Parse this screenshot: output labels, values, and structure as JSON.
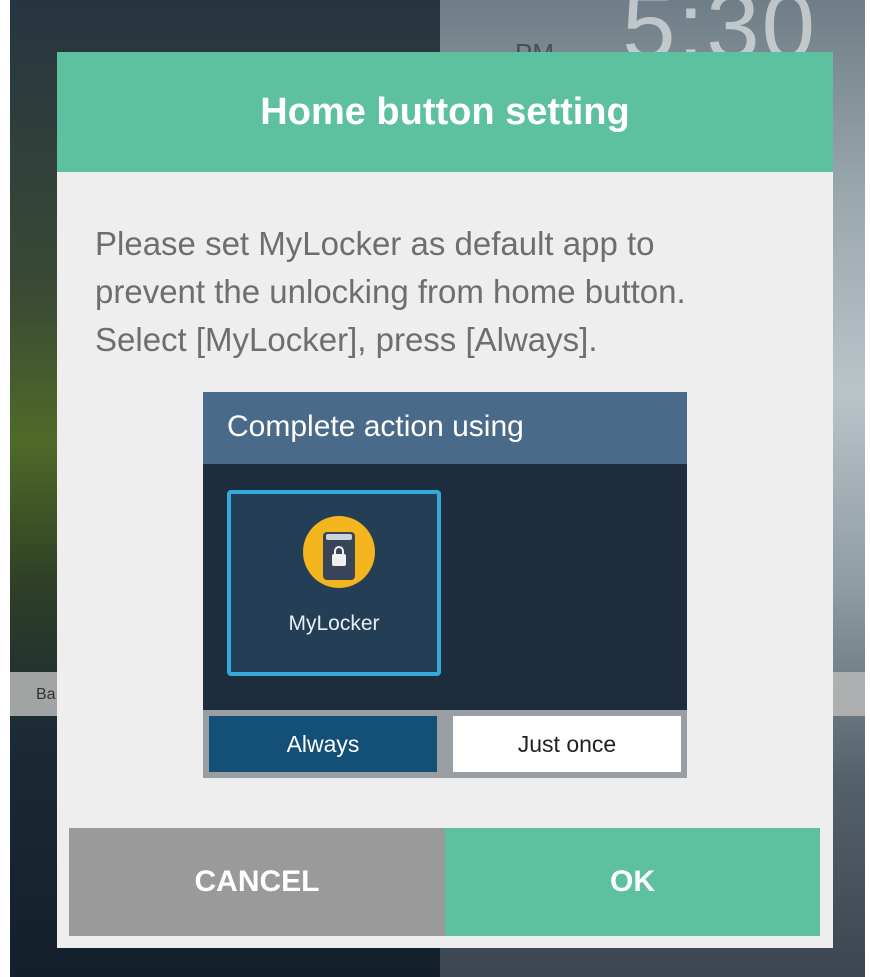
{
  "background": {
    "clock": "5:30",
    "ampm": "PM",
    "strip_text": "Ba"
  },
  "dialog": {
    "title": "Home button setting",
    "message_lines": [
      "Please set MyLocker as default app to",
      "prevent the unlocking from home button.",
      "Select [MyLocker], press [Always]."
    ],
    "illustration": {
      "title": "Complete action using",
      "app": {
        "label": "MyLocker",
        "icon": "lock-phone-icon"
      },
      "always_label": "Always",
      "just_once_label": "Just once"
    },
    "cancel_label": "CANCEL",
    "ok_label": "OK"
  },
  "colors": {
    "accent": "#5dc1a0",
    "cancel": "#9a9a9a",
    "selection_border": "#33aadc",
    "always_button": "#144f78"
  }
}
